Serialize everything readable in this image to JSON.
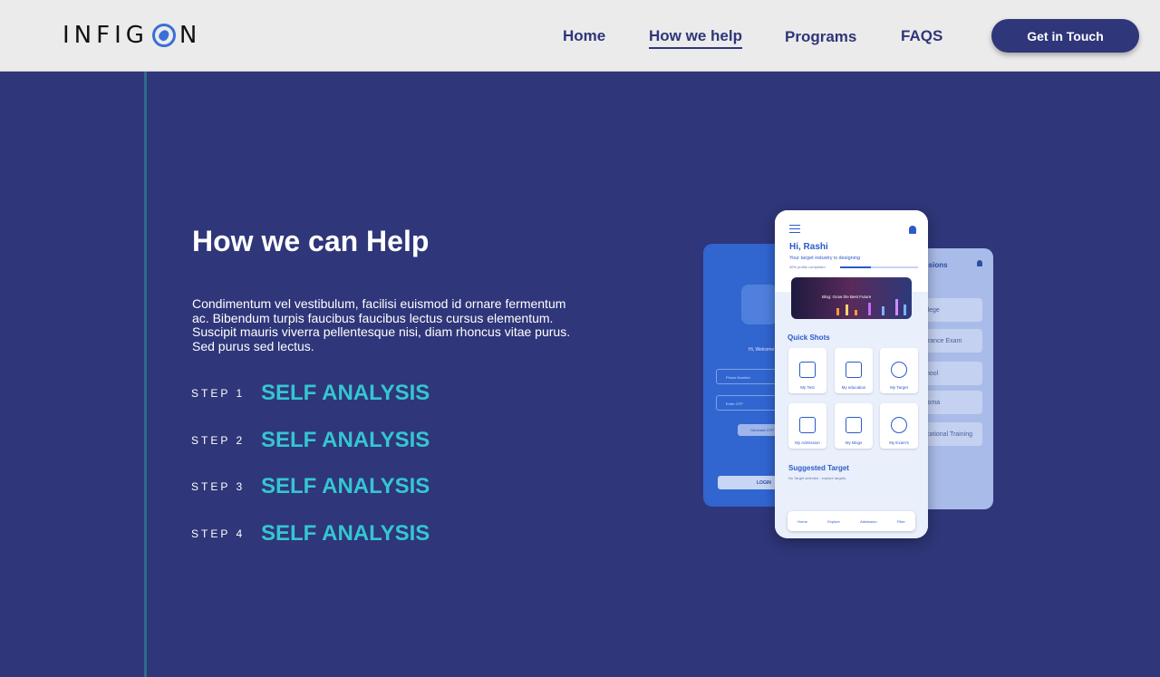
{
  "header": {
    "logo_text": "INFIGON",
    "nav": [
      {
        "label": "Home"
      },
      {
        "label": "How we help"
      },
      {
        "label": "Programs"
      },
      {
        "label": "FAQS"
      }
    ],
    "cta_label": "Get in Touch"
  },
  "main": {
    "title": "How we can Help",
    "description": "Condimentum vel vestibulum, facilisi euismod id ornare fermentum ac. Bibendum turpis faucibus faucibus lectus cursus elementum. Suscipit mauris viverra pellentesque nisi, diam rhoncus vitae purus. Sed purus sed lectus.",
    "steps": [
      {
        "label": "STEP 1",
        "value": "SELF ANALYSIS"
      },
      {
        "label": "STEP 2",
        "value": "SELF ANALYSIS"
      },
      {
        "label": "STEP 3",
        "value": "SELF ANALYSIS"
      },
      {
        "label": "STEP 4",
        "value": "SELF ANALYSIS"
      }
    ]
  },
  "mockup": {
    "greeting": "Hi, Rashi",
    "target_line": "Your target industry is designing",
    "profile_completion": "40% profile completed",
    "banner_text": "Blog: Grow the Best Future",
    "quick_shots_title": "Quick Shots",
    "tiles": [
      "My Test",
      "My education",
      "My Target",
      "My Admission",
      "My Blogs",
      "My Exam's"
    ],
    "suggested_title": "Suggested Target",
    "suggested_sub": "No Target selected , explore targets.",
    "bottom_nav": [
      "Home",
      "Explore",
      "Admission",
      "Filter"
    ],
    "left_screen": {
      "welcome": "Hi, Welcome",
      "phone_placeholder": "Phone Number",
      "otp_placeholder": "Enter OTP",
      "otp_button": "Generate OTP",
      "login_button": "LOGIN"
    },
    "right_screen": {
      "header": "issions",
      "items": [
        "llege",
        "trance Exam",
        "hool",
        "loma",
        "cational Training"
      ]
    }
  },
  "colors": {
    "background": "#2f3679",
    "accent": "#35c6d1",
    "header_bg": "#ebebeb"
  }
}
